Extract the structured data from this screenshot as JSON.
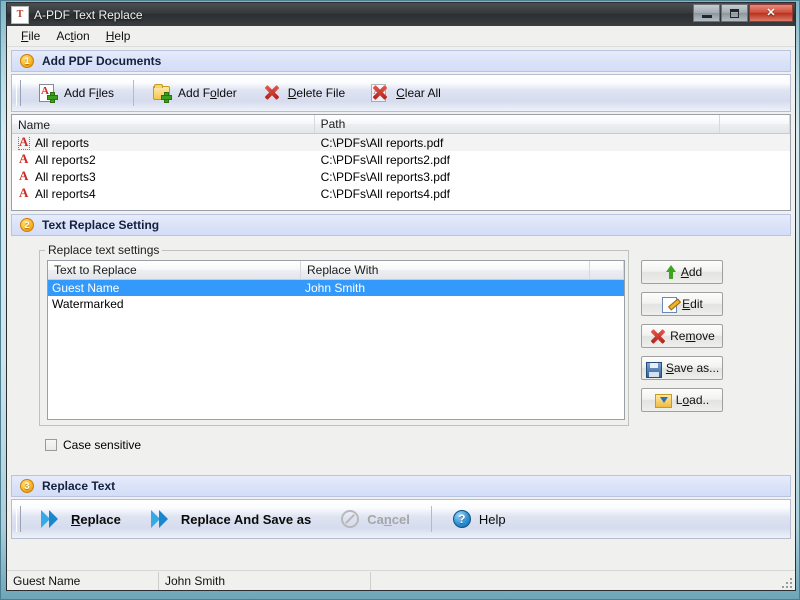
{
  "window": {
    "title": "A-PDF Text Replace",
    "icon": "app-icon",
    "buttons": {
      "minimize": "minimize-icon",
      "maximize": "maximize-icon",
      "close": "✕"
    }
  },
  "menu": {
    "items": [
      {
        "label": "File",
        "accel": "F"
      },
      {
        "label": "Action",
        "accel": "t"
      },
      {
        "label": "Help",
        "accel": "H"
      }
    ]
  },
  "section1": {
    "badge": "1",
    "title": "Add PDF Documents",
    "toolbar": [
      {
        "label": "Add Files",
        "icon": "add-files-icon"
      },
      {
        "label": "Add Folder",
        "icon": "add-folder-icon"
      },
      {
        "label": "Delete File",
        "icon": "delete-file-icon"
      },
      {
        "label": "Clear All",
        "icon": "clear-all-icon"
      }
    ],
    "list": {
      "columns": [
        "Name",
        "Path",
        ""
      ],
      "rows": [
        {
          "name": "All reports",
          "path": "C:\\PDFs\\All reports.pdf",
          "selected": true
        },
        {
          "name": "All reports2",
          "path": "C:\\PDFs\\All reports2.pdf",
          "selected": false
        },
        {
          "name": "All reports3",
          "path": "C:\\PDFs\\All reports3.pdf",
          "selected": false
        },
        {
          "name": "All reports4",
          "path": "C:\\PDFs\\All reports4.pdf",
          "selected": false
        }
      ]
    }
  },
  "section2": {
    "badge": "2",
    "title": "Text Replace Setting",
    "groupbox_label": "Replace text settings",
    "list": {
      "columns": [
        "Text to Replace",
        "Replace With",
        ""
      ],
      "rows": [
        {
          "text": "Guest Name",
          "with": "John Smith",
          "selected": true
        },
        {
          "text": "Watermarked",
          "with": "",
          "selected": false
        }
      ]
    },
    "buttons": [
      {
        "label": "Add",
        "icon": "arrow-up-icon"
      },
      {
        "label": "Edit",
        "icon": "edit-note-icon"
      },
      {
        "label": "Remove",
        "icon": "red-x-icon"
      },
      {
        "label": "Save as...",
        "icon": "floppy-disk-icon"
      },
      {
        "label": "Load..",
        "icon": "open-folder-icon"
      }
    ],
    "case_sensitive": {
      "label": "Case sensitive",
      "checked": false
    }
  },
  "section3": {
    "badge": "3",
    "title": "Replace Text",
    "actions": [
      {
        "label": "Replace",
        "icon": "double-chevron-icon",
        "disabled": false
      },
      {
        "label": "Replace And Save as",
        "icon": "double-chevron-icon",
        "disabled": false
      },
      {
        "label": "Cancel",
        "icon": "no-entry-icon",
        "disabled": true
      },
      {
        "label": "Help",
        "icon": "question-circle-icon",
        "disabled": false
      }
    ]
  },
  "statusbar": {
    "panel1": "Guest Name",
    "panel2": "John Smith",
    "panel3": ""
  },
  "colors": {
    "selection": "#3399fb",
    "section_header": "#dbe3f9",
    "badge": "#ffc02e",
    "close_button": "#cf4b37"
  }
}
